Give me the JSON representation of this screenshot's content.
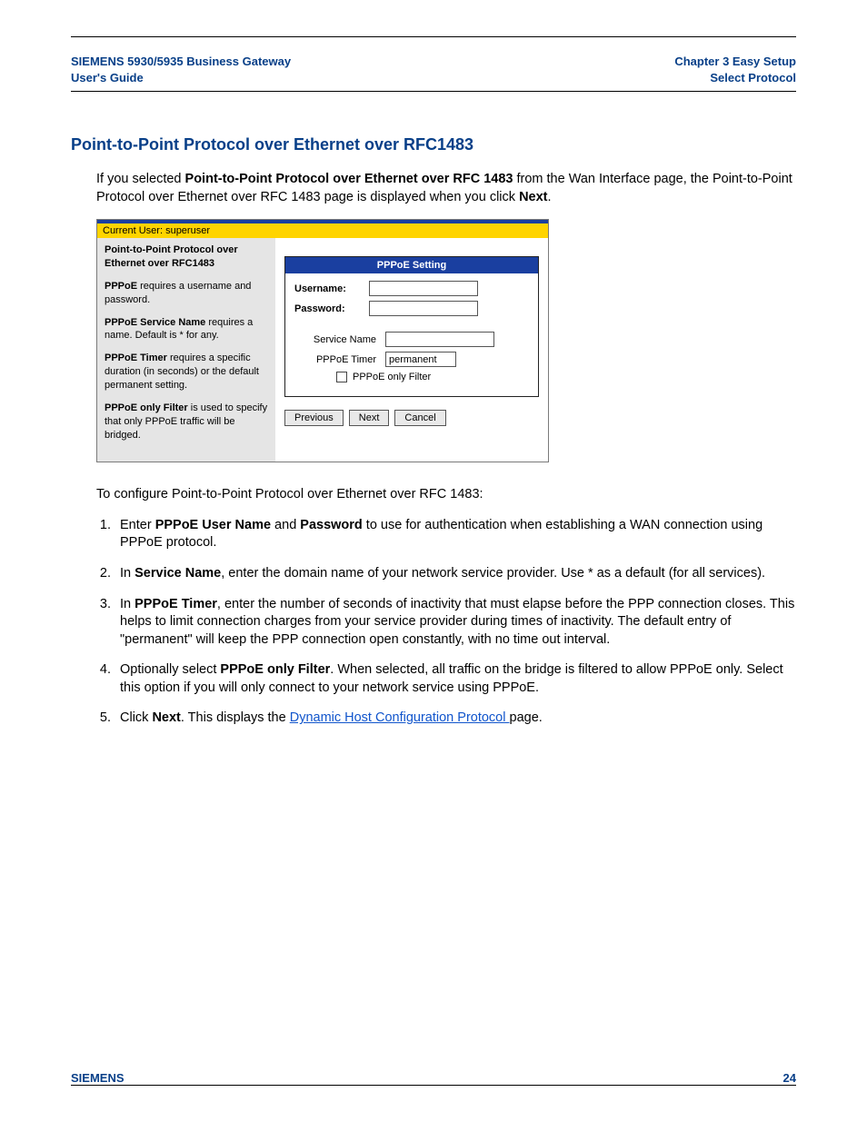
{
  "header": {
    "left_line1": "SIEMENS 5930/5935 Business Gateway",
    "left_line2": "User's Guide",
    "right_line1": "Chapter 3  Easy Setup",
    "right_line2": "Select Protocol"
  },
  "footer": {
    "left": "SIEMENS",
    "page": "24"
  },
  "section_title": "Point-to-Point Protocol over Ethernet over RFC1483",
  "intro": {
    "pre": "If you selected ",
    "bold": "Point-to-Point Protocol over Ethernet over RFC 1483",
    "mid": " from the Wan Interface page, the Point-to-Point Protocol over Ethernet over RFC 1483 page is displayed when you click ",
    "next": "Next",
    "post": "."
  },
  "mock": {
    "current_user": "Current User: superuser",
    "side_title": "Point-to-Point Protocol over Ethernet over RFC1483",
    "side_p1_b": "PPPoE",
    "side_p1": " requires a username and password.",
    "side_p2_b": "PPPoE Service Name",
    "side_p2": " requires a name. Default is * for any.",
    "side_p3_b": "PPPoE Timer",
    "side_p3": " requires a specific duration (in seconds) or the default permanent setting.",
    "side_p4_b": "PPPoE only Filter",
    "side_p4": " is used to specify that only PPPoE traffic will be bridged.",
    "panel_title": "PPPoE Setting",
    "lbl_username": "Username:",
    "lbl_password": "Password:",
    "lbl_service": "Service Name",
    "lbl_timer": "PPPoE Timer",
    "val_timer": "permanent",
    "lbl_filter": "PPPoE only Filter",
    "btn_prev": "Previous",
    "btn_next": "Next",
    "btn_cancel": "Cancel"
  },
  "lead_in": "To configure Point-to-Point Protocol over Ethernet over RFC 1483:",
  "steps": {
    "s1a": "Enter ",
    "s1b1": "PPPoE User Name",
    "s1c": " and ",
    "s1b2": "Password",
    "s1d": " to use for authentication when establishing a WAN connection using PPPoE protocol.",
    "s2a": "In ",
    "s2b": "Service Name",
    "s2c": ", enter the domain name of your network service provider. Use * as a default (for all services).",
    "s3a": "In ",
    "s3b": "PPPoE Timer",
    "s3c": ", enter the number of seconds of inactivity that must elapse before the PPP connection closes. This helps to limit connection charges from your service provider during times of inactivity. The default entry of \"permanent\" will keep the PPP connection open constantly, with no time out interval.",
    "s4a": "Optionally select ",
    "s4b": "PPPoE only Filter",
    "s4c": ". When selected, all traffic on the bridge is filtered to allow PPPoE only. Select this option if you will only connect to your network service using PPPoE.",
    "s5a": "Click ",
    "s5b": "Next",
    "s5c": ". This displays the ",
    "s5link": "Dynamic Host Configuration Protocol ",
    "s5d": "page."
  }
}
